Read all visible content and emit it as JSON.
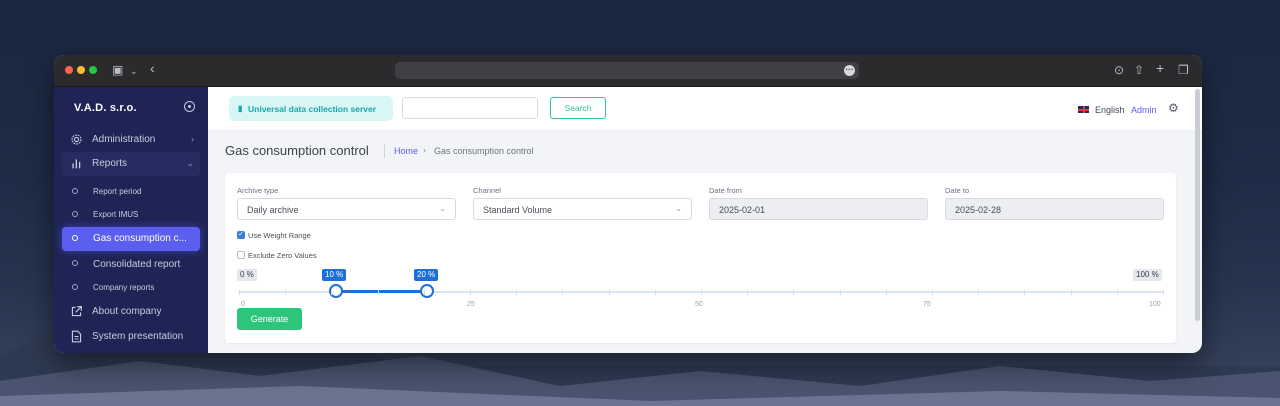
{
  "sidebar": {
    "brand": "V.A.D. s.r.o.",
    "items": [
      {
        "label": "Administration",
        "icon": "gear-icon"
      },
      {
        "label": "Reports",
        "icon": "bar-chart-icon"
      }
    ],
    "sub_items": [
      {
        "label": "Report period"
      },
      {
        "label": "Export IMUS"
      },
      {
        "label": "Gas consumption c...",
        "active": true
      },
      {
        "label": "Consolidated report"
      },
      {
        "label": "Company reports"
      }
    ],
    "bottom_items": [
      {
        "label": "About company",
        "icon": "external-link-icon"
      },
      {
        "label": "System presentation",
        "icon": "document-icon"
      }
    ]
  },
  "topbar": {
    "app_name": "Universal data collection server",
    "search_value": "",
    "search_button": "Search",
    "language": "English",
    "user": "Admin"
  },
  "page": {
    "title": "Gas consumption control",
    "breadcrumb_home": "Home",
    "breadcrumb_current": "Gas consumption control"
  },
  "form": {
    "archive_type_label": "Archive type",
    "archive_type_value": "Daily archive",
    "channel_label": "Channel",
    "channel_value": "Standard Volume",
    "date_from_label": "Date from",
    "date_from_value": "2025-02-01",
    "date_to_label": "Date to",
    "date_to_value": "2025-02-28",
    "use_weight_range_label": "Use Weight Range",
    "use_weight_range_checked": true,
    "exclude_zero_label": "Exclude Zero Values",
    "exclude_zero_checked": false,
    "range": {
      "min_label": "0 %",
      "max_label": "100 %",
      "low_label": "10 %",
      "high_label": "20 %",
      "low_value": 10,
      "high_value": 20,
      "ticks": [
        "0",
        "25",
        "50",
        "75",
        "100"
      ]
    },
    "generate_button": "Generate"
  },
  "colors": {
    "sidebar_bg": "#1f2455",
    "accent": "#5b5ff0",
    "slider": "#1e6fd9",
    "success": "#2dc57b",
    "teal": "#16a8a8"
  }
}
